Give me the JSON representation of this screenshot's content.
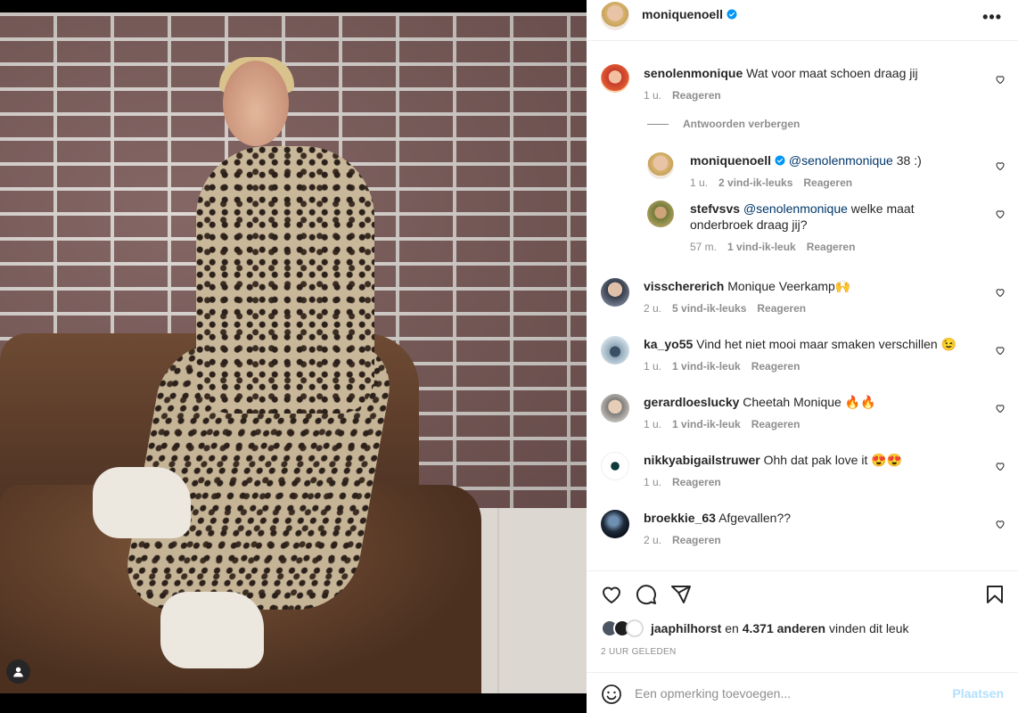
{
  "post": {
    "owner": "moniquenoell",
    "owner_verified": true,
    "more_label": "•••"
  },
  "comments": [
    {
      "user": "senolenmonique",
      "text": "Wat voor maat schoen draag jij",
      "time": "1 u.",
      "likes": "",
      "reply": "Reageren"
    },
    {
      "user": "visschererich",
      "text": "Monique Veerkamp🙌",
      "time": "2 u.",
      "likes": "5 vind-ik-leuks",
      "reply": "Reageren"
    },
    {
      "user": "ka_yo55",
      "text": "Vind het niet mooi maar smaken verschillen 😉",
      "time": "1 u.",
      "likes": "1 vind-ik-leuk",
      "reply": "Reageren"
    },
    {
      "user": "gerardloeslucky",
      "text": "Cheetah Monique 🔥🔥",
      "time": "1 u.",
      "likes": "1 vind-ik-leuk",
      "reply": "Reageren"
    },
    {
      "user": "nikkyabigailstruwer",
      "text": "Ohh dat pak love it 😍😍",
      "time": "1 u.",
      "likes": "",
      "reply": "Reageren"
    },
    {
      "user": "broekkie_63",
      "text": "Afgevallen??",
      "time": "2 u.",
      "likes": "",
      "reply": "Reageren"
    }
  ],
  "hide_replies_label": "Antwoorden verbergen",
  "replies": [
    {
      "user": "moniquenoell",
      "mention": "@senolenmonique",
      "text": " 38 :)",
      "time": "1 u.",
      "likes": "2 vind-ik-leuks",
      "reply": "Reageren"
    },
    {
      "user": "stefvsvs",
      "mention": "@senolenmonique",
      "text": " welke maat onderbroek draag jij?",
      "time": "57 m.",
      "likes": "1 vind-ik-leuk",
      "reply": "Reageren"
    }
  ],
  "likes": {
    "first_user": "jaaphilhorst",
    "connector": " en ",
    "others": "4.371 anderen",
    "suffix": " vinden dit leuk"
  },
  "timestamp": "2 UUR GELEDEN",
  "add_comment": {
    "placeholder": "Een opmerking toevoegen...",
    "post_label": "Plaatsen"
  },
  "colors": {
    "verified": "#0095f6",
    "post_button_disabled": "#b2dffc",
    "mention": "#00376b"
  }
}
